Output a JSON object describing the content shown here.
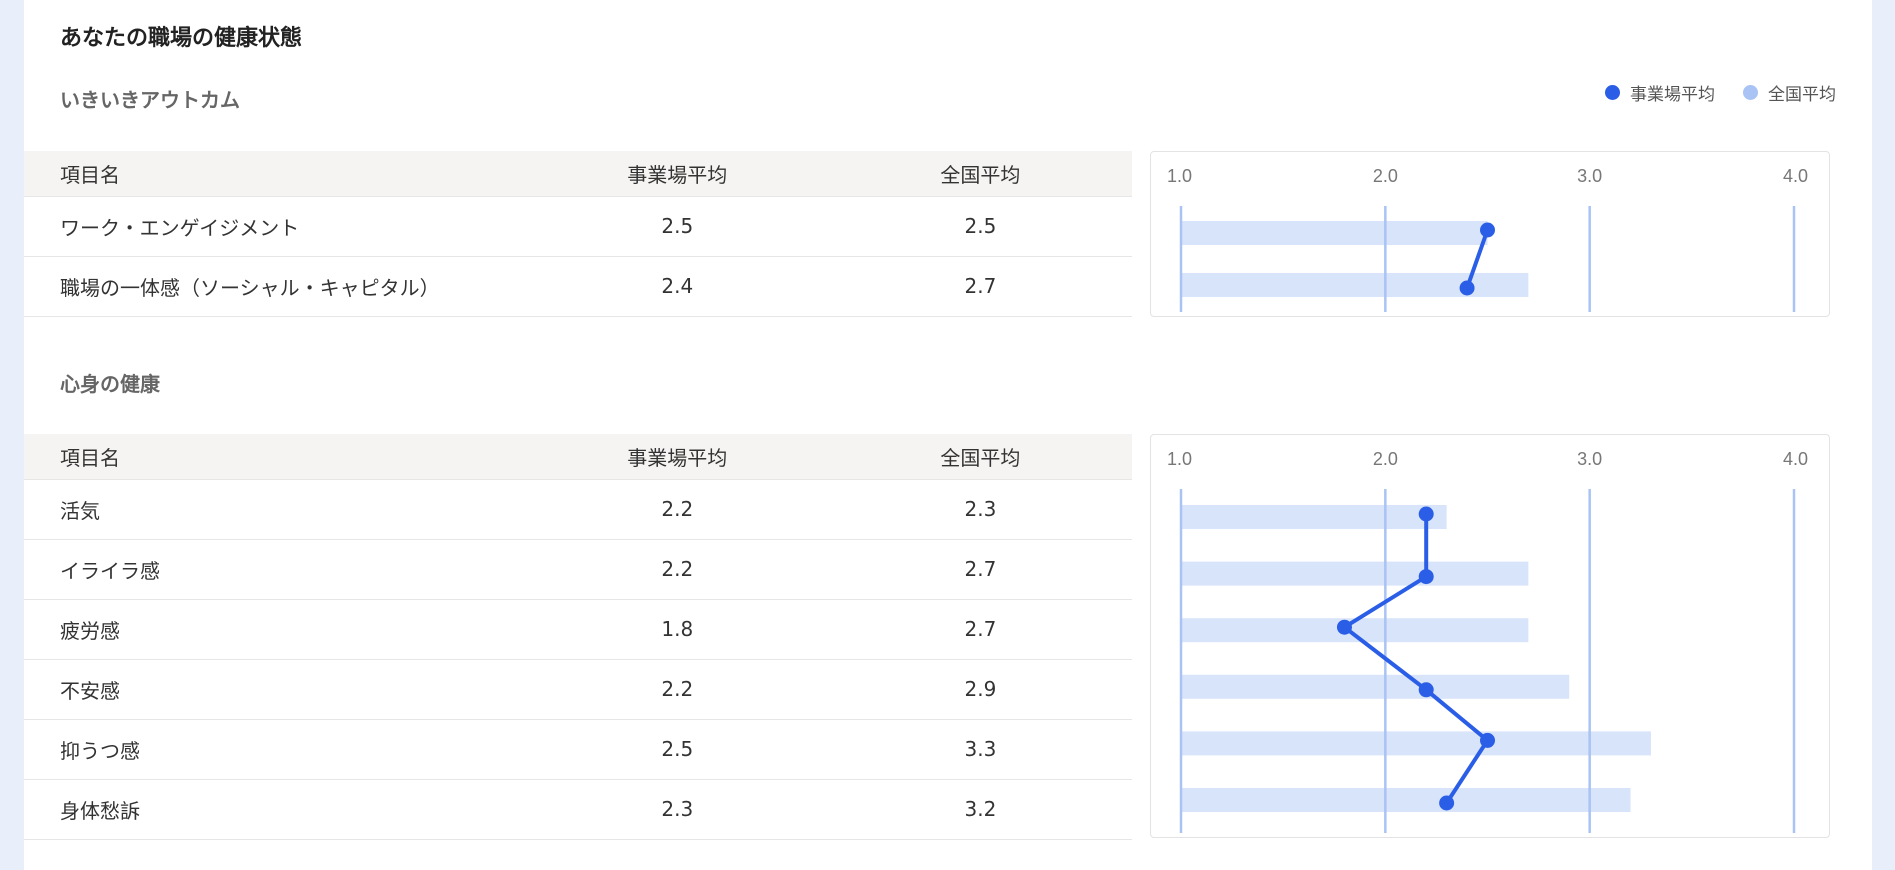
{
  "page_title": "あなたの職場の健康状態",
  "legend": {
    "workplace_label": "事業場平均",
    "national_label": "全国平均",
    "workplace_color": "#2b5ee6",
    "national_color": "#a9c3f5"
  },
  "sections": [
    {
      "title": "いきいきアウトカム",
      "headers": {
        "name": "項目名",
        "workplace": "事業場平均",
        "national": "全国平均"
      },
      "rows": [
        {
          "name": "ワーク・エンゲイジメント",
          "workplace": "2.5",
          "national": "2.5"
        },
        {
          "name": "職場の一体感（ソーシャル・キャピタル）",
          "workplace": "2.4",
          "national": "2.7"
        }
      ]
    },
    {
      "title": "心身の健康",
      "headers": {
        "name": "項目名",
        "workplace": "事業場平均",
        "national": "全国平均"
      },
      "rows": [
        {
          "name": "活気",
          "workplace": "2.2",
          "national": "2.3"
        },
        {
          "name": "イライラ感",
          "workplace": "2.2",
          "national": "2.7"
        },
        {
          "name": "疲労感",
          "workplace": "1.8",
          "national": "2.7"
        },
        {
          "name": "不安感",
          "workplace": "2.2",
          "national": "2.9"
        },
        {
          "name": "抑うつ感",
          "workplace": "2.5",
          "national": "3.3"
        },
        {
          "name": "身体愁訴",
          "workplace": "2.3",
          "national": "3.2"
        }
      ]
    }
  ],
  "chart_data": [
    {
      "type": "bar",
      "ticks": [
        "1.0",
        "2.0",
        "3.0",
        "4.0"
      ],
      "xlim": [
        1.0,
        4.0
      ],
      "categories": [
        "ワーク・エンゲイジメント",
        "職場の一体感（ソーシャル・キャピタル）"
      ],
      "series": [
        {
          "name": "全国平均",
          "type": "bar",
          "values": [
            2.5,
            2.7
          ]
        },
        {
          "name": "事業場平均",
          "type": "line",
          "values": [
            2.5,
            2.4
          ]
        }
      ]
    },
    {
      "type": "bar",
      "ticks": [
        "1.0",
        "2.0",
        "3.0",
        "4.0"
      ],
      "xlim": [
        1.0,
        4.0
      ],
      "categories": [
        "活気",
        "イライラ感",
        "疲労感",
        "不安感",
        "抑うつ感",
        "身体愁訴"
      ],
      "series": [
        {
          "name": "全国平均",
          "type": "bar",
          "values": [
            2.3,
            2.7,
            2.7,
            2.9,
            3.3,
            3.2
          ]
        },
        {
          "name": "事業場平均",
          "type": "line",
          "values": [
            2.2,
            2.2,
            1.8,
            2.2,
            2.5,
            2.3
          ]
        }
      ]
    }
  ]
}
